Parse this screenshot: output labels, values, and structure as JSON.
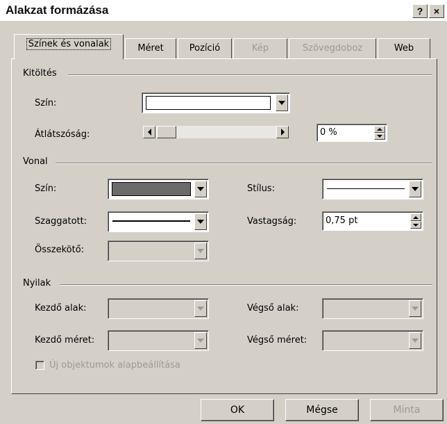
{
  "window": {
    "title": "Alakzat formázása",
    "help_label": "?",
    "close_label": "×"
  },
  "tabs": [
    {
      "label": "Színek és vonalak",
      "active": true,
      "enabled": true
    },
    {
      "label": "Méret",
      "enabled": true
    },
    {
      "label": "Pozíció",
      "enabled": true
    },
    {
      "label": "Kép",
      "enabled": false
    },
    {
      "label": "Szövegdoboz",
      "enabled": false
    },
    {
      "label": "Web",
      "enabled": true
    }
  ],
  "fill": {
    "group_label": "Kitöltés",
    "color_label": "Szín:",
    "color_value": "#ffffff",
    "transparency_label": "Átlátszóság:",
    "transparency_value": "0 %",
    "transparency_level": 0
  },
  "line": {
    "group_label": "Vonal",
    "color_label": "Szín:",
    "color_value": "#6b6b6b",
    "style_label": "Stílus:",
    "dashed_label": "Szaggatott:",
    "weight_label": "Vastagság:",
    "weight_value": "0,75 pt",
    "connector_label": "Összekötő:"
  },
  "arrows": {
    "group_label": "Nyilak",
    "begin_style_label": "Kezdő alak:",
    "end_style_label": "Végső alak:",
    "begin_size_label": "Kezdő méret:",
    "end_size_label": "Végső méret:"
  },
  "default_checkbox_label": "Új objektumok alapbeállítása",
  "buttons": {
    "ok": "OK",
    "cancel": "Mégse",
    "preview": "Minta"
  }
}
